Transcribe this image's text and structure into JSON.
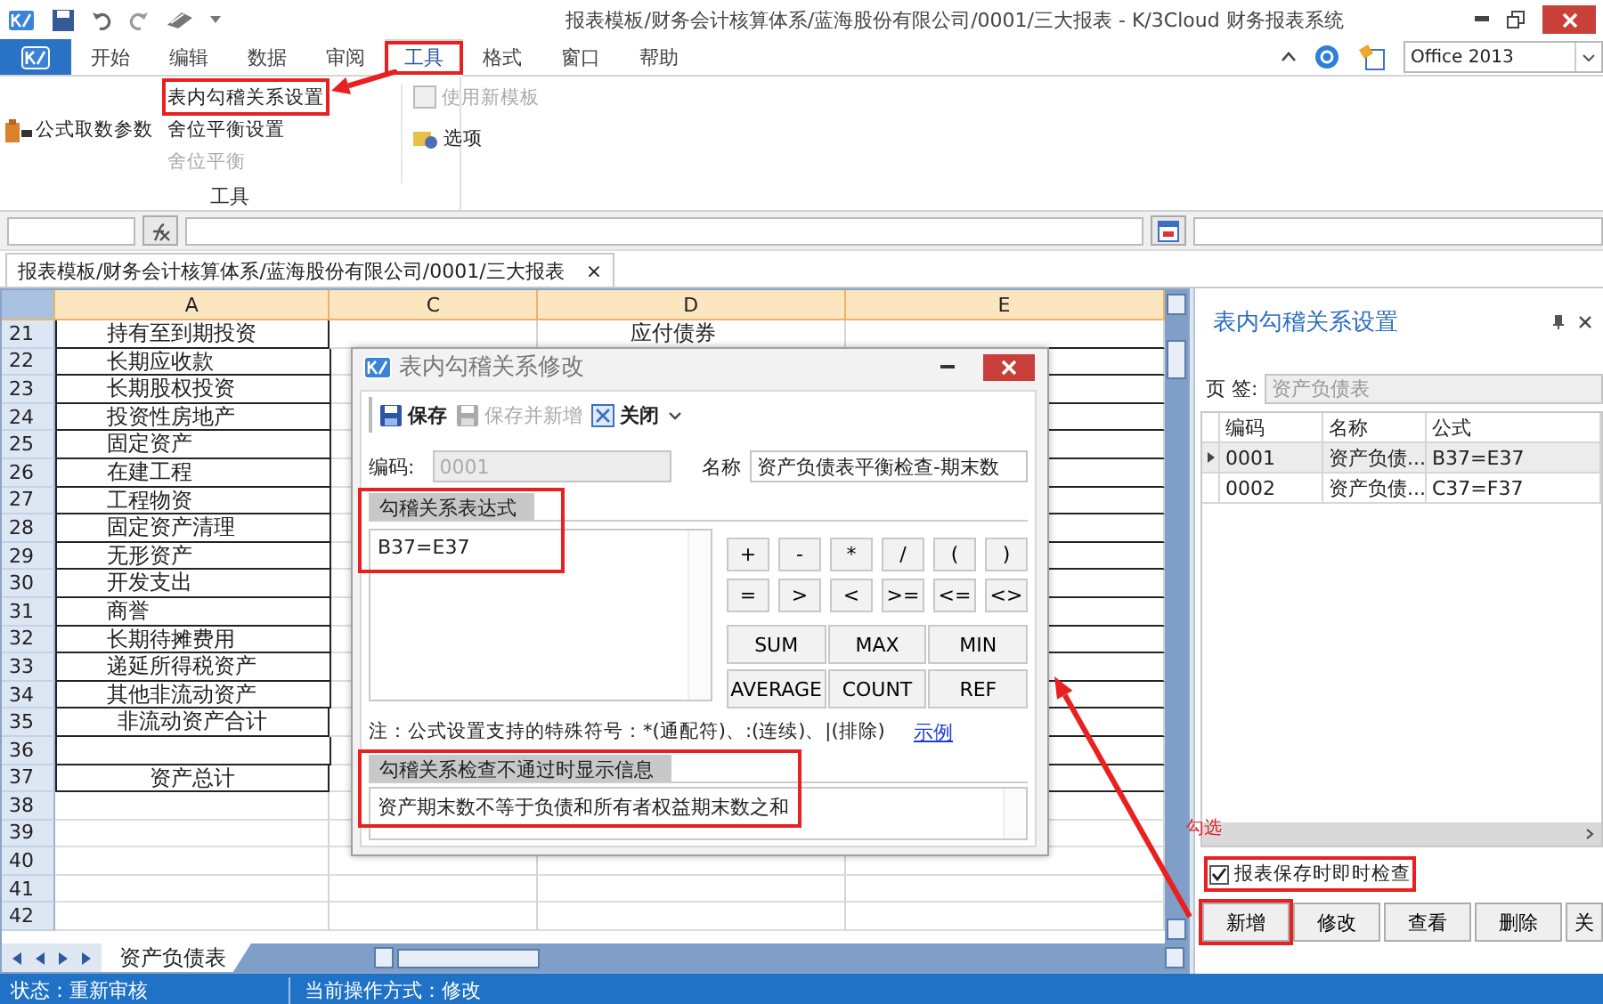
{
  "window": {
    "title": "报表模板/财务会计核算体系/蓝海股份有限公司/0001/三大报表 - K/3Cloud 财务报表系统"
  },
  "ribbon": {
    "tabs": [
      {
        "label": "开始",
        "selected": false,
        "highlighted": false
      },
      {
        "label": "编辑",
        "selected": false,
        "highlighted": false
      },
      {
        "label": "数据",
        "selected": false,
        "highlighted": false
      },
      {
        "label": "审阅",
        "selected": false,
        "highlighted": false
      },
      {
        "label": "工具",
        "selected": true,
        "highlighted": true
      },
      {
        "label": "格式",
        "selected": false,
        "highlighted": false
      },
      {
        "label": "窗口",
        "selected": false,
        "highlighted": false
      },
      {
        "label": "帮助",
        "selected": false,
        "highlighted": false
      }
    ],
    "theme": "Office 2013",
    "group": {
      "label": "工具",
      "big_button": "公式取数参数",
      "column_1": [
        {
          "label": "表内勾稽关系设置",
          "disabled": false,
          "highlighted": true
        },
        {
          "label": "舍位平衡设置",
          "disabled": false,
          "highlighted": false
        },
        {
          "label": "舍位平衡",
          "disabled": true,
          "highlighted": false
        }
      ],
      "column_2": [
        {
          "label": "使用新模板",
          "disabled": true
        },
        {
          "label": "选项",
          "disabled": false
        }
      ]
    }
  },
  "document_tab": {
    "label": "报表模板/财务会计核算体系/蓝海股份有限公司/0001/三大报表",
    "close": "×"
  },
  "sheet": {
    "columns": [
      "A",
      "C",
      "D",
      "E"
    ],
    "rows": [
      {
        "num": "21",
        "a": "持有至到期投资",
        "d": "应付债券",
        "centered": false,
        "bordered": true
      },
      {
        "num": "22",
        "a": "长期应收款",
        "centered": false,
        "bordered": true
      },
      {
        "num": "23",
        "a": "长期股权投资",
        "centered": false,
        "bordered": true
      },
      {
        "num": "24",
        "a": "投资性房地产",
        "centered": false,
        "bordered": true
      },
      {
        "num": "25",
        "a": "固定资产",
        "centered": false,
        "bordered": true
      },
      {
        "num": "26",
        "a": "在建工程",
        "centered": false,
        "bordered": true
      },
      {
        "num": "27",
        "a": "工程物资",
        "centered": false,
        "bordered": true
      },
      {
        "num": "28",
        "a": "固定资产清理",
        "centered": false,
        "bordered": true
      },
      {
        "num": "29",
        "a": "无形资产",
        "centered": false,
        "bordered": true
      },
      {
        "num": "30",
        "a": "开发支出",
        "centered": false,
        "bordered": true
      },
      {
        "num": "31",
        "a": "商誉",
        "centered": false,
        "bordered": true
      },
      {
        "num": "32",
        "a": "长期待摊费用",
        "centered": false,
        "bordered": true
      },
      {
        "num": "33",
        "a": "递延所得税资产",
        "centered": false,
        "bordered": true
      },
      {
        "num": "34",
        "a": "其他非流动资产",
        "centered": false,
        "bordered": true
      },
      {
        "num": "35",
        "a": "非流动资产合计",
        "centered": true,
        "bordered": true
      },
      {
        "num": "36",
        "bordered": true
      },
      {
        "num": "37",
        "a": "资产总计",
        "centered": true,
        "bordered": true
      },
      {
        "num": "38",
        "bordered": false
      },
      {
        "num": "39",
        "bordered": false
      },
      {
        "num": "40",
        "bordered": false
      },
      {
        "num": "41",
        "bordered": false
      },
      {
        "num": "42",
        "bordered": false
      }
    ],
    "sheet_tabs": [
      {
        "label": "资产负债表",
        "selected": true
      }
    ]
  },
  "dialog": {
    "title": "表内勾稽关系修改",
    "toolbar": [
      {
        "label": "保存",
        "kind": "save",
        "disabled": false
      },
      {
        "label": "保存并新增",
        "kind": "save",
        "disabled": true
      },
      {
        "label": "关闭",
        "kind": "close",
        "disabled": false
      }
    ],
    "code_label": "编码:",
    "code_value": "0001",
    "name_label": "名称",
    "name_value": "资产负债表平衡检查-期末数",
    "expression_section": "勾稽关系表达式",
    "expression": "B37=E37",
    "expression_highlighted": true,
    "operators": [
      "+",
      "-",
      "*",
      "/",
      "(",
      ")",
      "=",
      ">",
      "<",
      ">=",
      "<=",
      "<>"
    ],
    "functions": [
      "SUM",
      "MAX",
      "MIN",
      "AVERAGE",
      "COUNT",
      "REF"
    ],
    "note": "注：公式设置支持的特殊符号：*(通配符)、:(连续)、|(排除)",
    "example_link": "示例",
    "message_section": "勾稽关系检查不通过时显示信息",
    "message": "资产期末数不等于负债和所有者权益期末数之和",
    "message_highlighted": true
  },
  "panel": {
    "title": "表内勾稽关系设置",
    "tab_label": "页 签:",
    "tab_value": "资产负债表",
    "columns": [
      "编码",
      "名称",
      "公式"
    ],
    "rows": [
      {
        "code": "0001",
        "name": "资产负债...",
        "formula": "B37=E37",
        "selected": true
      },
      {
        "code": "0002",
        "name": "资产负债...",
        "formula": "C37=F37",
        "selected": false
      }
    ],
    "check": {
      "label": "报表保存时即时检查",
      "checked": true,
      "highlighted": true
    },
    "buttons": [
      {
        "label": "新增",
        "highlighted": true
      },
      {
        "label": "修改",
        "highlighted": false
      },
      {
        "label": "查看",
        "highlighted": false
      },
      {
        "label": "删除",
        "highlighted": false
      },
      {
        "label": "关",
        "highlighted": false
      }
    ]
  },
  "annotation": {
    "note": "勾选"
  },
  "status_bar": [
    "状态：重新审核",
    "当前操作方式：修改"
  ]
}
